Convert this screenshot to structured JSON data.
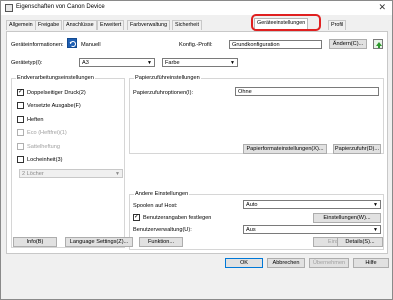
{
  "window": {
    "title": "Eigenschaften von Canon Device"
  },
  "tabs": [
    {
      "label": "Allgemein"
    },
    {
      "label": "Freigabe"
    },
    {
      "label": "Anschlüsse"
    },
    {
      "label": "Erweitert"
    },
    {
      "label": "Farbverwaltung"
    },
    {
      "label": "Sicherheit"
    },
    {
      "label": "Geräteeinstellungen"
    },
    {
      "label": "Profil"
    }
  ],
  "top": {
    "device_info_label": "Geräteinformationen:",
    "device_info_mode": "Manuell",
    "config_profile_label": "Konfig.-Profil:",
    "config_profile_value": "Grundkonfiguration",
    "change_button": "Ändern(C)...",
    "device_type_label": "Gerätetyp(I):",
    "paper_size_value": "A3",
    "color_value": "Farbe"
  },
  "finishing": {
    "title": "Endverarbeitungseinstellungen",
    "duplex": "Doppelseitiger Druck(2)",
    "offset": "Versetzte Ausgabe(F)",
    "staple": "Heften",
    "eco": "Eco (Heftfrei)(1)",
    "saddle": "Sattelheftung",
    "punch": "Locheinheit(3)",
    "punch_value": "2 Löcher"
  },
  "paper_source": {
    "title": "Papierzuführeinstellungen",
    "options_label": "Papierzufuhroptionen(I):",
    "options_value": "Ohne",
    "format_button": "Papierformateinstellungen(X)...",
    "source_button": "Papierzufuhr(D)..."
  },
  "other": {
    "title": "Andere Einstellungen",
    "spool_label": "Spoolen auf Host:",
    "spool_value": "Auto",
    "user_info": "Benutzerangaben festlegen",
    "settings_button": "Einstellungen(W)...",
    "user_mgmt_label": "Benutzerverwaltung(U):",
    "user_mgmt_value": "Aus",
    "settings2_button": "Einstellungen..."
  },
  "bottom_buttons": {
    "info": "Info(B)",
    "language": "Language Settings(Z)...",
    "function": "Funktion...",
    "details": "Details(S)..."
  },
  "dialog_buttons": {
    "ok": "OK",
    "cancel": "Abbrechen",
    "apply": "Übernehmen",
    "help": "Hilfe"
  },
  "colors": {
    "highlight": "#e02020"
  }
}
